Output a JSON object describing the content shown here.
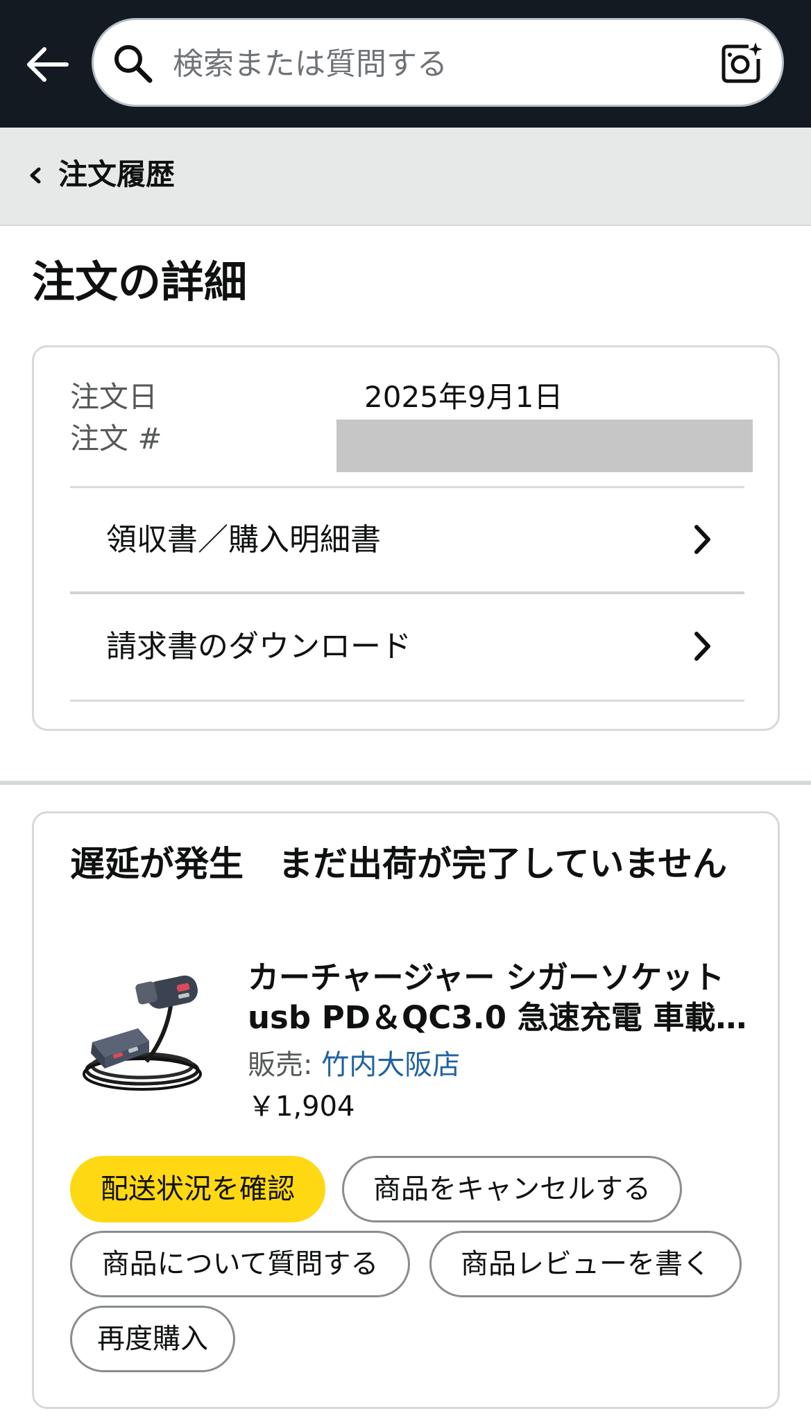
{
  "search": {
    "placeholder": "検索または質問する"
  },
  "breadcrumb": {
    "label": "注文履歴"
  },
  "page": {
    "title": "注文の詳細"
  },
  "order_info": {
    "date_label": "注文日",
    "date_value": "2025年9月1日",
    "number_label": "注文 #",
    "number_value_redacted": true
  },
  "links": [
    {
      "label": "領収書／購入明細書"
    },
    {
      "label": "請求書のダウンロード"
    }
  ],
  "shipment": {
    "status": "遅延が発生　まだ出荷が完了していません",
    "product": {
      "title_line1": "カーチャージャー シガーソケット",
      "title_line2": "usb PD＆QC3.0 急速充電 車載…",
      "seller_prefix": "販売: ",
      "seller_name": "竹内大阪店",
      "price": "￥1,904"
    },
    "actions": {
      "track": "配送状況を確認",
      "cancel": "商品をキャンセルする",
      "ask": "商品について質問する",
      "review": "商品レビューを書く",
      "rebuy": "再度購入"
    }
  },
  "colors": {
    "topbar": "#131a22",
    "primary_button": "#ffd814",
    "link": "#2162a1",
    "breadcrumb_bg": "#e7e9e9"
  }
}
